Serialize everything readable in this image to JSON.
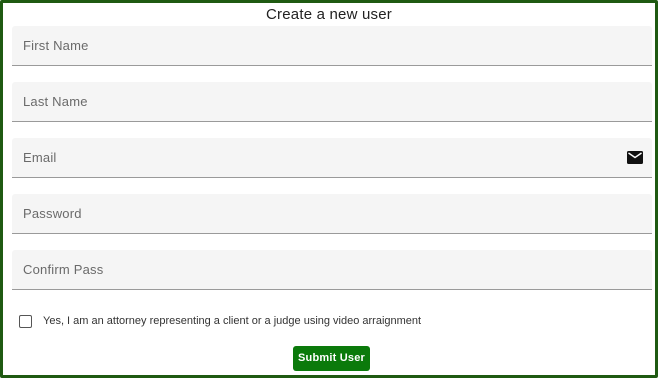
{
  "form": {
    "title": "Create a new user",
    "fields": [
      {
        "placeholder": "First Name",
        "value": ""
      },
      {
        "placeholder": "Last Name",
        "value": ""
      },
      {
        "placeholder": "Email",
        "value": "",
        "icon": "envelope-icon"
      },
      {
        "placeholder": "Password",
        "value": ""
      },
      {
        "placeholder": "Confirm Pass",
        "value": ""
      }
    ],
    "attorney_checkbox": {
      "label": "Yes, I am an attorney representing a client or a judge using video arraignment",
      "checked": false
    },
    "submit_label": "Submit User"
  },
  "colors": {
    "frame_border": "#1f5a12",
    "submit_bg": "#0b7a0b",
    "field_bg": "#f5f5f5"
  }
}
